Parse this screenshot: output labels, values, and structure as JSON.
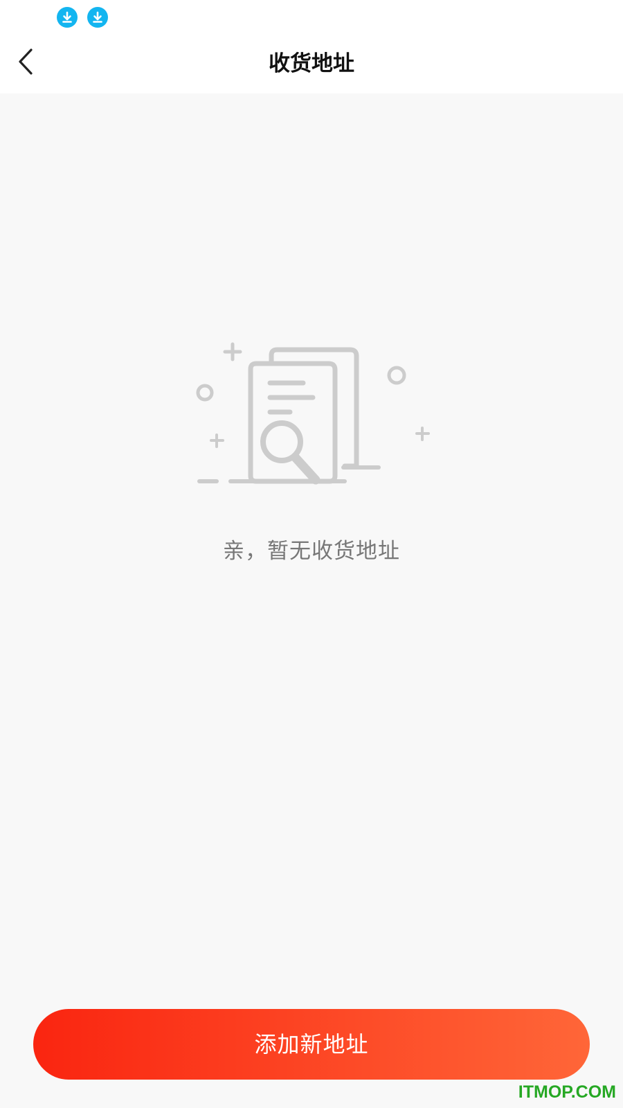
{
  "status_bar": {
    "icons": [
      "download-icon",
      "download-icon"
    ],
    "icon_color": "#13b5f0"
  },
  "header": {
    "title": "收货地址",
    "back_icon": "chevron-left-icon"
  },
  "empty_state": {
    "illustration": "empty-document-search-icon",
    "message": "亲，暂无收货地址"
  },
  "footer": {
    "add_button_label": "添加新地址",
    "button_gradient": [
      "#fa2510",
      "#ff6638"
    ]
  },
  "watermark": {
    "text": "ITMOP.COM",
    "color": "#26a824"
  }
}
